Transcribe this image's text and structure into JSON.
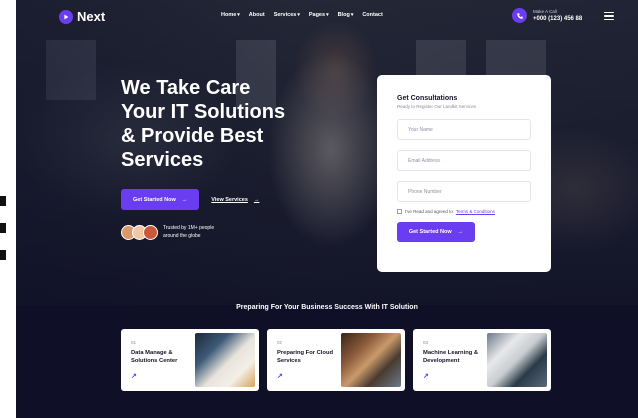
{
  "brand": {
    "name": "Next"
  },
  "nav": {
    "items": [
      {
        "label": "Home",
        "has_dropdown": true
      },
      {
        "label": "About",
        "has_dropdown": false
      },
      {
        "label": "Services",
        "has_dropdown": true
      },
      {
        "label": "Pages",
        "has_dropdown": true
      },
      {
        "label": "Blog",
        "has_dropdown": true
      },
      {
        "label": "Contact",
        "has_dropdown": false
      }
    ],
    "dropdown_glyph": "▾"
  },
  "call": {
    "label": "Make A Call",
    "number": "+000 (123) 456 88"
  },
  "hero": {
    "headline_lines": [
      "We Take Care",
      "Your IT Solutions",
      "& Provide Best",
      "Services"
    ],
    "primary_cta": "Get Started Now",
    "secondary_cta": "View Services",
    "trusted_line1": "Trusted by 1M+ people",
    "trusted_line2": "around the globe"
  },
  "form": {
    "title": "Get Consultations",
    "subtitle": "Ready to Register Our Landkit Services",
    "fields": [
      {
        "placeholder": "Your Name"
      },
      {
        "placeholder": "Email Address"
      },
      {
        "placeholder": "Phone Number"
      }
    ],
    "agree_text": "I've Read and agreed to",
    "agree_link": "Terms & Conditions",
    "submit": "Get Started Now"
  },
  "services": {
    "title": "Preparing For Your Business Success With IT Solution",
    "cards": [
      {
        "number": "01",
        "title": "Data Manage & Solutions Center"
      },
      {
        "number": "02",
        "title": "Preparing For Cloud Services"
      },
      {
        "number": "03",
        "title": "Machine Learning & Development"
      }
    ],
    "arrow_glyph": "↗"
  },
  "colors": {
    "accent": "#6a3df0",
    "dark_bg": "#0f1028"
  },
  "icons": [
    "logo-icon",
    "phone-icon",
    "hamburger-menu-icon",
    "arrow-right-icon"
  ]
}
